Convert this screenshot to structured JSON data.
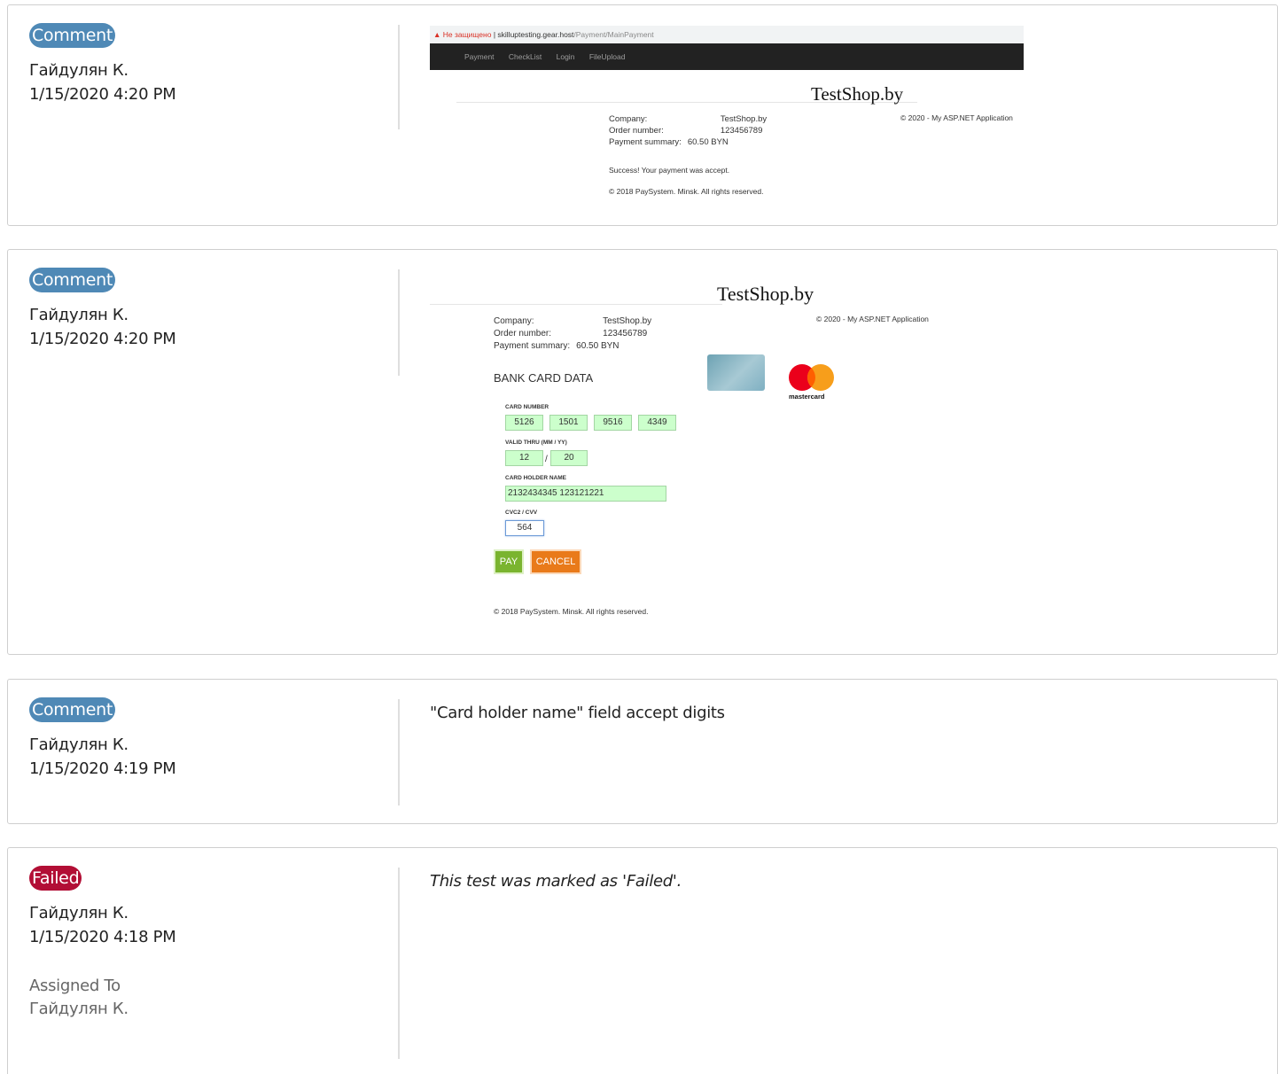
{
  "entries": [
    {
      "badge": "Comment",
      "author": "Гайдулян К.",
      "timestamp": "1/15/2020 4:20 PM",
      "screenshot": {
        "address_warning": "Не защищено",
        "address_separator": "|",
        "address_host": "skilluptesting.gear.host",
        "address_path": "/Payment/MainPayment",
        "nav": [
          "Payment",
          "CheckList",
          "Login",
          "FileUpload"
        ],
        "shop_title": "TestShop.by",
        "copyright_app": "© 2020 - My ASP.NET Application",
        "company_label": "Company:",
        "company_value": "TestShop.by",
        "order_label": "Order number:",
        "order_value": "123456789",
        "summary_label": "Payment summary:",
        "summary_value": "60.50 BYN",
        "success": "Success! Your payment was accept.",
        "footer": "© 2018 PaySystem. Minsk. All rights reserved."
      }
    },
    {
      "badge": "Comment",
      "author": "Гайдулян К.",
      "timestamp": "1/15/2020 4:20 PM",
      "screenshot": {
        "shop_title": "TestShop.by",
        "copyright_app": "© 2020 - My ASP.NET Application",
        "company_label": "Company:",
        "company_value": "TestShop.by",
        "order_label": "Order number:",
        "order_value": "123456789",
        "summary_label": "Payment summary:",
        "summary_value": "60.50 BYN",
        "bank_title": "BANK CARD DATA",
        "card_number_label": "CARD NUMBER",
        "card_number": [
          "5126",
          "1501",
          "9516",
          "4349"
        ],
        "valid_label": "VALID THRU (MM / YY)",
        "valid_month": "12",
        "valid_sep": "/",
        "valid_year": "20",
        "holder_label": "CARD HOLDER NAME",
        "holder_value": "2132434345 123121221",
        "cvv_label": "CVC2 / CVV",
        "cvv_value": "564",
        "pay_label": "PAY",
        "cancel_label": "CANCEL",
        "mastercard_text": "mastercard",
        "footer": "© 2018 PaySystem. Minsk. All rights reserved."
      }
    },
    {
      "badge": "Comment",
      "author": "Гайдулян К.",
      "timestamp": "1/15/2020 4:19 PM",
      "text": "\"Card holder name\" field accept digits"
    },
    {
      "badge": "Failed",
      "author": "Гайдулян К.",
      "timestamp": "1/15/2020 4:18 PM",
      "assigned_label": "Assigned To",
      "assigned_value": "Гайдулян К.",
      "text": "This test was marked as 'Failed'."
    }
  ],
  "colors": {
    "comment_badge": "#4f89b6",
    "failed_badge": "#b20e35",
    "pay_button": "#7ab42f",
    "cancel_button": "#e97a1a",
    "field_filled": "#ccffcc"
  }
}
